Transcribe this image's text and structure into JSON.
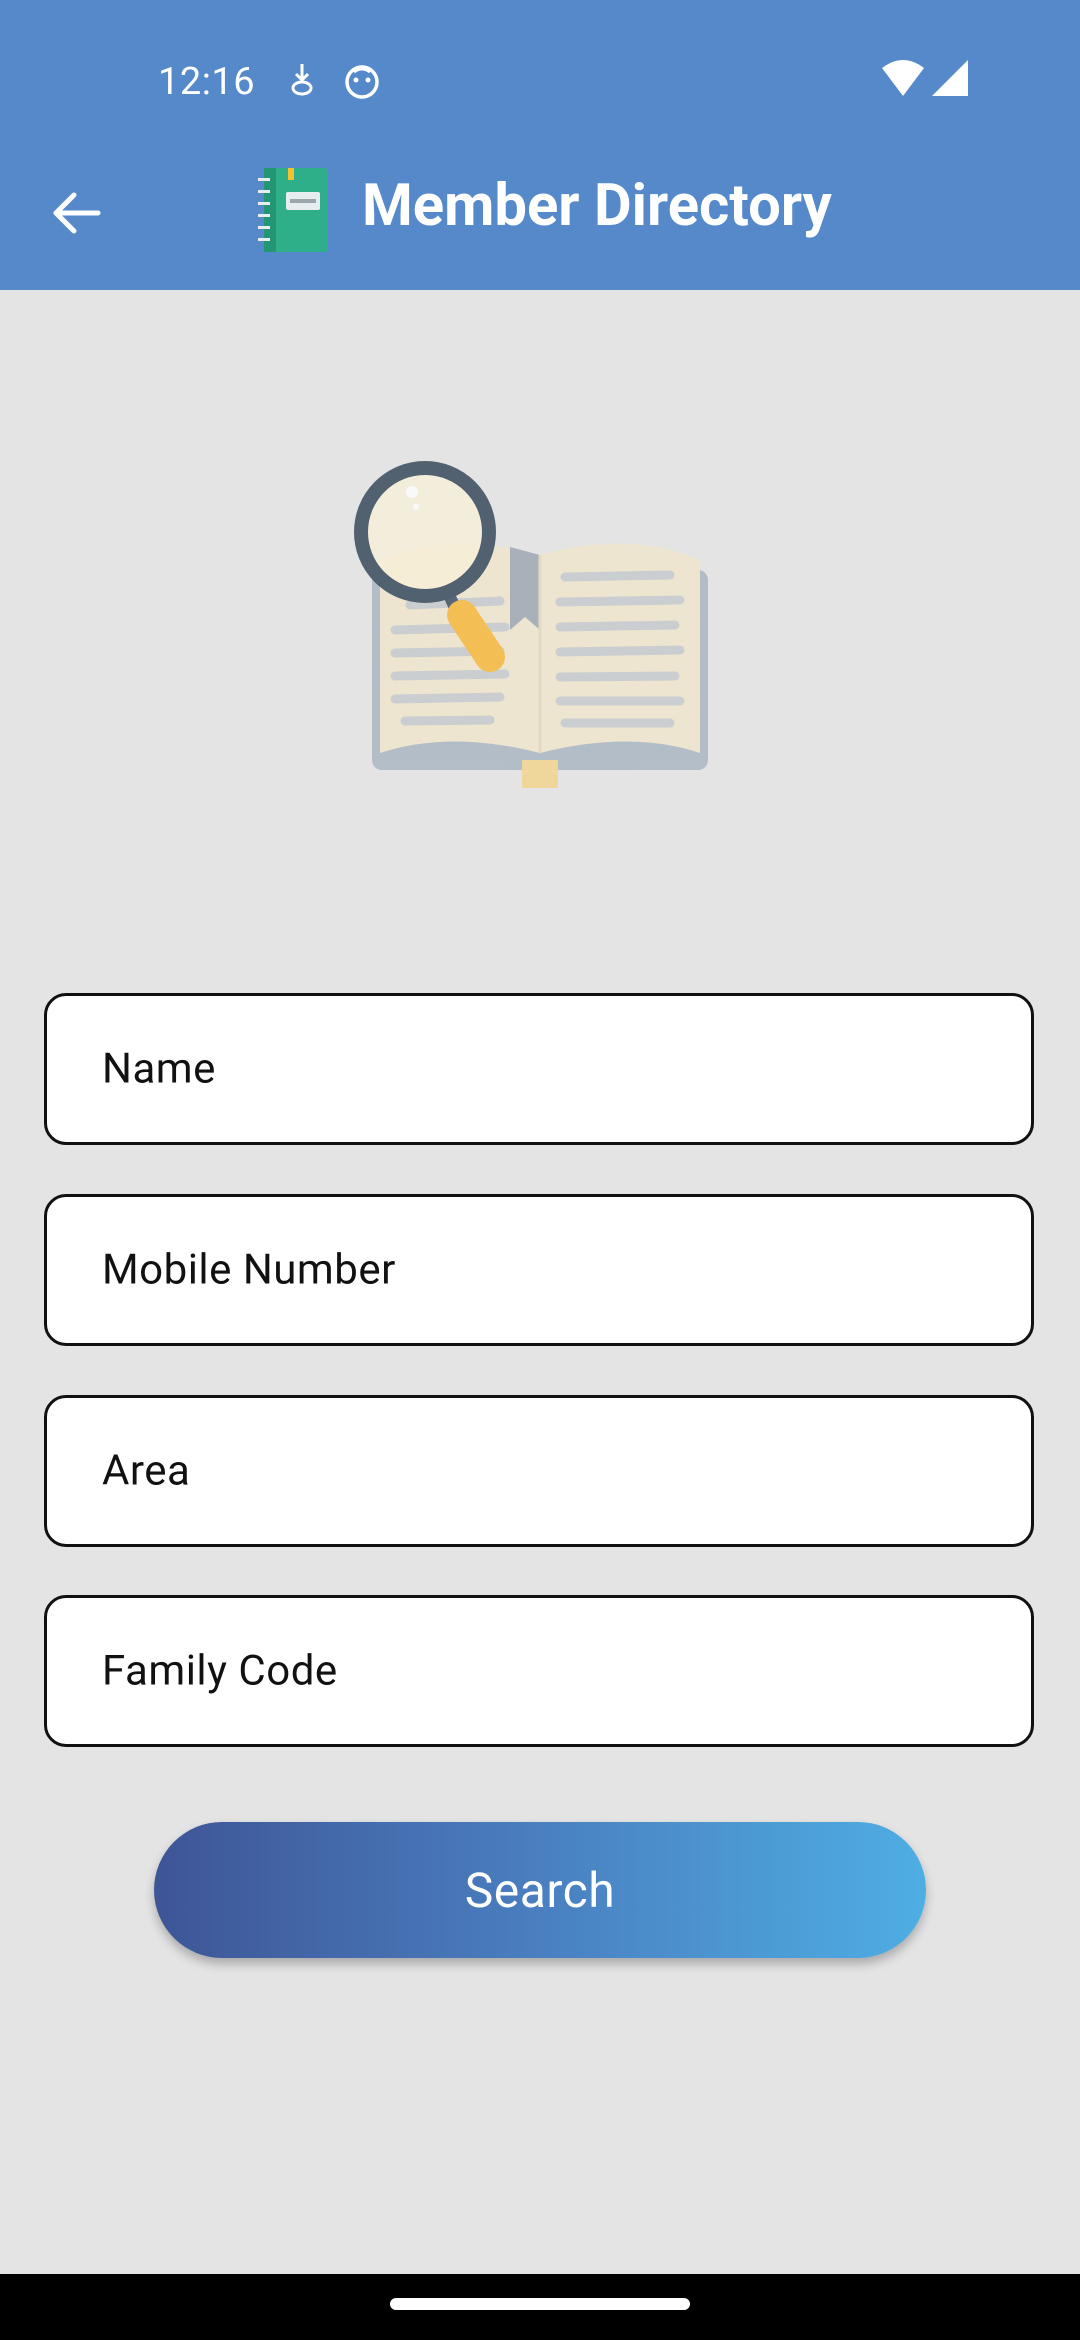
{
  "status_bar": {
    "time": "12:16",
    "icons": [
      "download-icon",
      "assistant-icon",
      "wifi-icon",
      "signal-icon"
    ]
  },
  "app_bar": {
    "title": "Member Directory",
    "back_icon": "arrow-left-icon",
    "logo_icon": "notebook-icon"
  },
  "hero_image": "book-magnifier-illustration",
  "form": {
    "fields": [
      {
        "label": "Name"
      },
      {
        "label": "Mobile Number"
      },
      {
        "label": "Area"
      },
      {
        "label": "Family Code"
      }
    ],
    "search_label": "Search"
  },
  "colors": {
    "app_bar": "#5589c9",
    "background": "#e4e4e4",
    "button_start": "#3e5596",
    "button_end": "#4eaee3"
  }
}
